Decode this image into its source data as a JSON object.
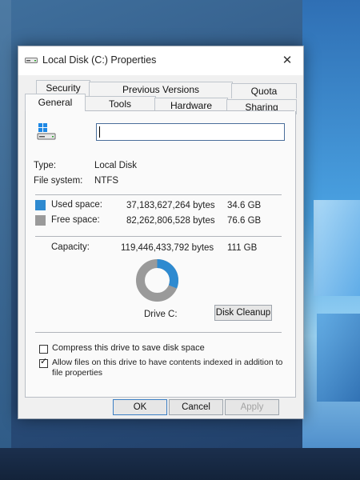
{
  "window": {
    "title": "Local Disk (C:) Properties"
  },
  "tabs_row1": [
    {
      "label": "Security"
    },
    {
      "label": "Previous Versions"
    },
    {
      "label": "Quota"
    }
  ],
  "tabs_row2": [
    {
      "label": "General"
    },
    {
      "label": "Tools"
    },
    {
      "label": "Hardware"
    },
    {
      "label": "Sharing"
    }
  ],
  "active_tab": "General",
  "general": {
    "name_value": "",
    "type_label": "Type:",
    "type_value": "Local Disk",
    "fs_label": "File system:",
    "fs_value": "NTFS",
    "used_label": "Used space:",
    "used_bytes": "37,183,627,264 bytes",
    "used_human": "34.6 GB",
    "free_label": "Free space:",
    "free_bytes": "82,262,806,528 bytes",
    "free_human": "76.6 GB",
    "capacity_label": "Capacity:",
    "capacity_bytes": "119,446,433,792 bytes",
    "capacity_human": "111 GB",
    "drive_label": "Drive C:",
    "cleanup_label": "Disk Cleanup",
    "compress_label": "Compress this drive to save disk space",
    "compress_checked": false,
    "index_label_line1": "Allow files on this drive to have contents indexed in addition to",
    "index_label_line2": "file properties",
    "index_checked": true,
    "used_fraction": 0.3113
  },
  "colors": {
    "used": "#2e8ad0",
    "free": "#9a9a9a"
  },
  "buttons": {
    "ok": "OK",
    "cancel": "Cancel",
    "apply": "Apply"
  }
}
